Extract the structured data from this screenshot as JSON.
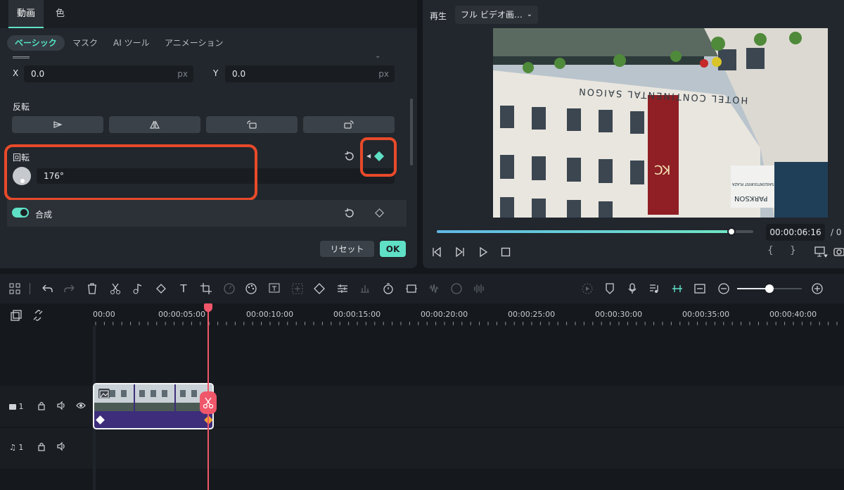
{
  "panel": {
    "tabs": [
      "動画",
      "色"
    ],
    "subtabs": [
      "ベーシック",
      "マスク",
      "AI ツール",
      "アニメーション"
    ],
    "position": {
      "x_label": "X",
      "x_value": "0.0",
      "y_label": "Y",
      "y_value": "0.0",
      "unit": "px"
    },
    "flip_title": "反転",
    "rotate_title": "回転",
    "rotate_value": "176°",
    "composite_label": "合成",
    "reset_button": "リセット",
    "ok_button": "OK"
  },
  "preview": {
    "play_label": "再生",
    "quality_select": "フル ビデオ画…",
    "timecode": "00:00:06:16",
    "timecode_sep": "/ 0",
    "progress_fraction": 0.93,
    "video_texts": {
      "hotel": "HOTEL CONTINENTAL SAIGON",
      "parkson": "PARKSON",
      "plaza": "SAIGONTOURIST PLAZA",
      "banner": "KC"
    }
  },
  "timeline": {
    "ruler": [
      "00:00",
      "00:00:05:00",
      "00:00:10:00",
      "00:00:15:00",
      "00:00:20:00",
      "00:00:25:00",
      "00:00:30:00",
      "00:00:35:00",
      "00:00:40:00"
    ],
    "video_track_label": "1",
    "audio_track_label": "1",
    "zoom_fraction": 0.5
  },
  "colors": {
    "accent": "#5fe0c6",
    "highlight": "#e84a2a",
    "playhead": "#f0576a",
    "clip": "#3d2d7a"
  }
}
